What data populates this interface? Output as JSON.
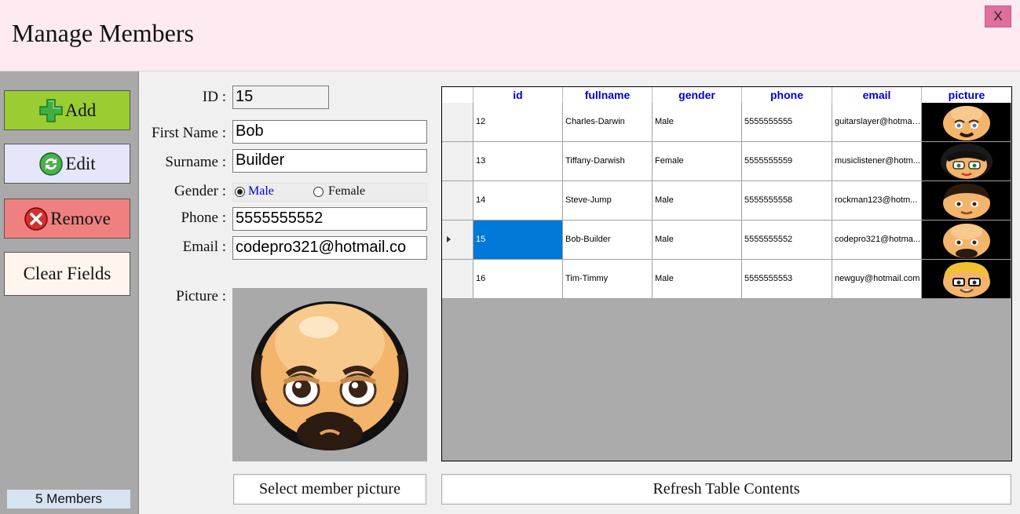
{
  "window": {
    "title": "Manage Members",
    "close_label": "X"
  },
  "sidebar": {
    "add_label": "Add",
    "edit_label": "Edit",
    "remove_label": "Remove",
    "clear_label": "Clear Fields",
    "members_count": "5 Members",
    "colors": {
      "add": "#9acd32",
      "edit": "#e6e6fa",
      "remove": "#f08080",
      "clear": "#fff5ee"
    }
  },
  "form": {
    "id_label": "ID :",
    "id_value": "15",
    "first_name_label": "First Name :",
    "first_name_value": "Bob",
    "surname_label": "Surname :",
    "surname_value": "Builder",
    "gender_label": "Gender :",
    "gender_options": [
      "Male",
      "Female"
    ],
    "gender_selected": "Male",
    "phone_label": "Phone :",
    "phone_value": "5555555552",
    "email_label": "Email :",
    "email_value": "codepro321@hotmail.co",
    "picture_label": "Picture :",
    "picture_icon": "bald-bearded-man-avatar-icon",
    "select_picture_label": "Select member picture"
  },
  "table": {
    "columns": [
      "id",
      "fullname",
      "gender",
      "phone",
      "email",
      "picture"
    ],
    "selected_row": 3,
    "rows": [
      {
        "id": "12",
        "fullname": "Charles-Darwin",
        "gender": "Male",
        "phone": "5555555555",
        "email": "guitarslayer@hotmail...",
        "picture": "bald-man-avatar-icon"
      },
      {
        "id": "13",
        "fullname": "Tiffany-Darwish",
        "gender": "Female",
        "phone": "5555555559",
        "email": "musiclistener@hotm...",
        "picture": "woman-glasses-avatar-icon"
      },
      {
        "id": "14",
        "fullname": "Steve-Jump",
        "gender": "Male",
        "phone": "5555555558",
        "email": "rockman123@hotm...",
        "picture": "dark-hair-man-avatar-icon"
      },
      {
        "id": "15",
        "fullname": "Bob-Builder",
        "gender": "Male",
        "phone": "5555555552",
        "email": "codepro321@hotma...",
        "picture": "bald-bearded-man-avatar-icon"
      },
      {
        "id": "16",
        "fullname": "Tim-Timmy",
        "gender": "Male",
        "phone": "5555555553",
        "email": "newguy@hotmail.com",
        "picture": "blond-glasses-man-avatar-icon"
      }
    ]
  },
  "refresh_label": "Refresh Table Contents"
}
